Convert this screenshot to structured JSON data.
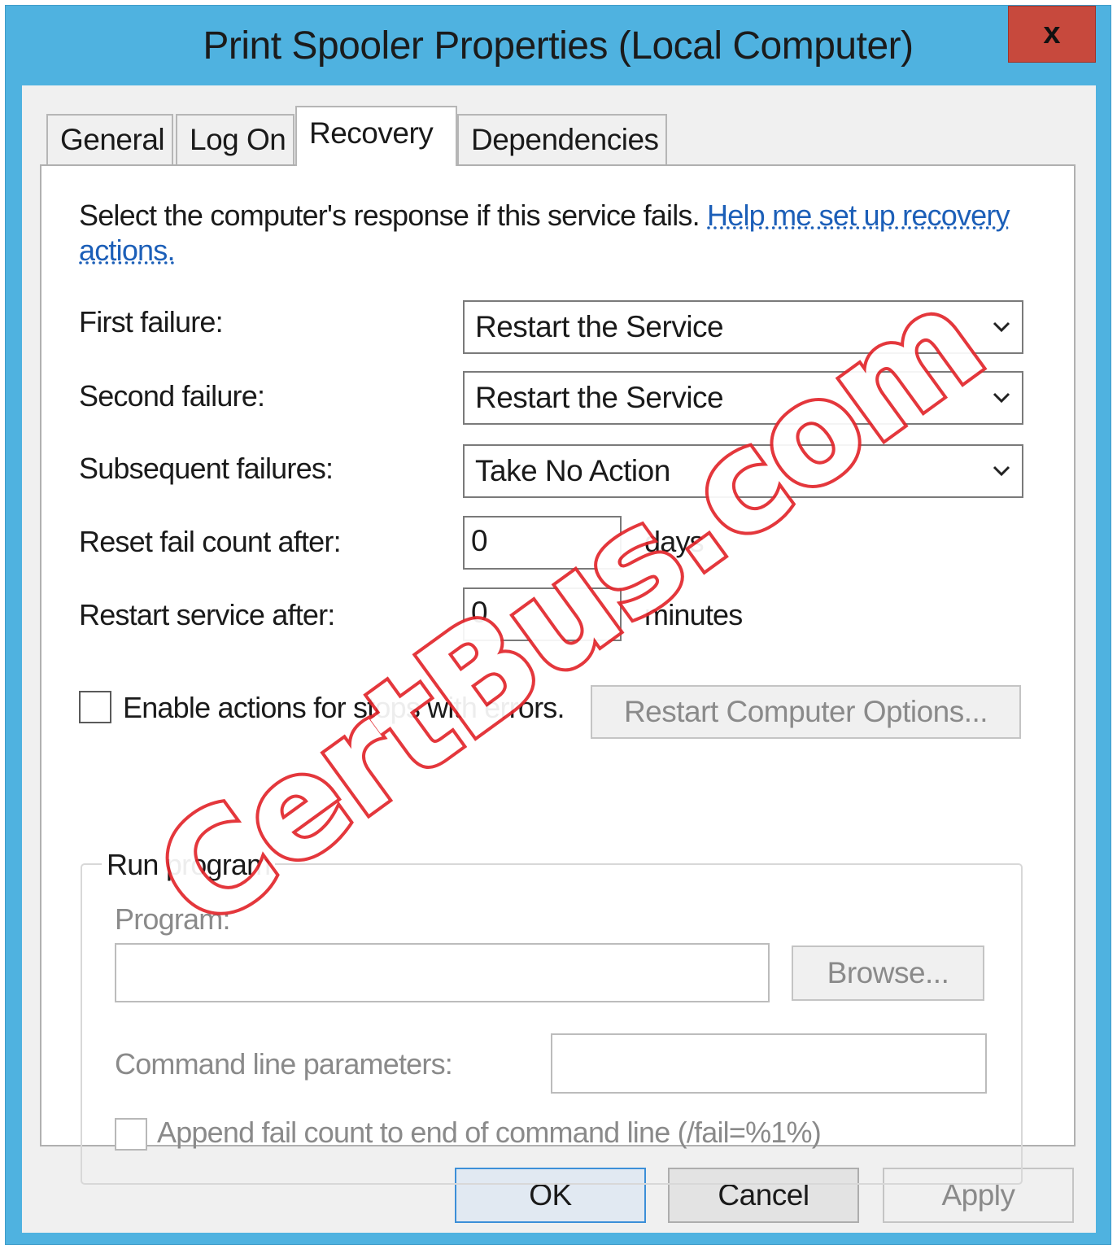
{
  "window": {
    "title": "Print Spooler Properties (Local Computer)",
    "close_glyph": "x"
  },
  "tabs": [
    {
      "label": "General",
      "active": false
    },
    {
      "label": "Log On",
      "active": false
    },
    {
      "label": "Recovery",
      "active": true
    },
    {
      "label": "Dependencies",
      "active": false
    }
  ],
  "recovery": {
    "intro": "Select the computer's response if this service fails.",
    "help_link_line1": "Help me set up recovery",
    "help_link_line2": "actions.",
    "first_failure": {
      "label": "First failure:",
      "value": "Restart the Service"
    },
    "second_failure": {
      "label": "Second failure:",
      "value": "Restart the Service"
    },
    "subsequent_failures": {
      "label": "Subsequent failures:",
      "value": "Take No Action"
    },
    "reset_fail_count": {
      "label": "Reset fail count after:",
      "value": "0",
      "unit": "days"
    },
    "restart_service": {
      "label": "Restart service after:",
      "value": "0",
      "unit": "minutes"
    },
    "enable_actions": {
      "label": "Enable actions for stops with errors.",
      "checked": false
    },
    "restart_computer_options": "Restart Computer Options...",
    "run_program": {
      "group_title": "Run program",
      "program_label": "Program:",
      "program_value": "",
      "browse": "Browse...",
      "cmd_label": "Command line parameters:",
      "cmd_value": "",
      "append_label": "Append fail count to end of command line (/fail=%1%)",
      "append_checked": false
    }
  },
  "footer": {
    "ok": "OK",
    "cancel": "Cancel",
    "apply": "Apply"
  },
  "watermark": "CertBus.com",
  "colors": {
    "title_bar": "#4fb2e0",
    "close": "#c7493d",
    "link": "#1c5fb8",
    "watermark": "#e2272c"
  },
  "icons": {
    "dropdown": "chevron-down-icon",
    "close": "close-icon"
  }
}
